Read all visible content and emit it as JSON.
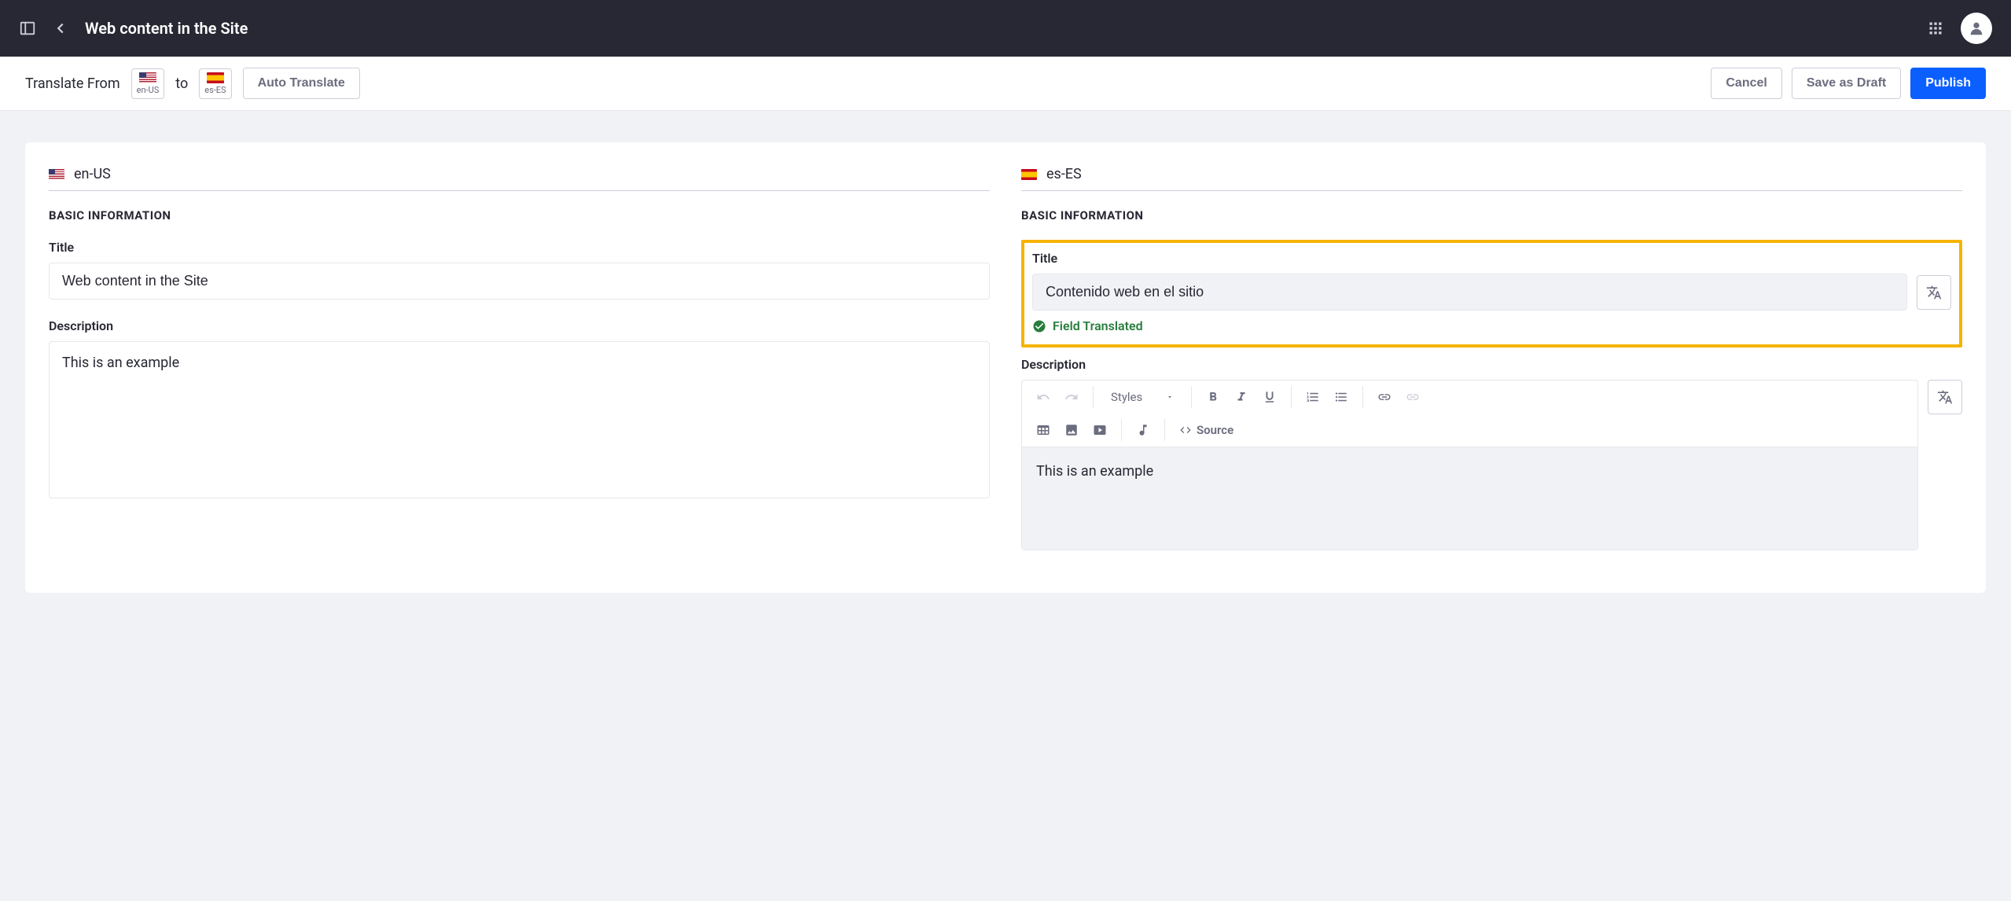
{
  "topbar": {
    "title": "Web content in the Site"
  },
  "toolbar": {
    "translate_from_label": "Translate From",
    "to_label": "to",
    "from_lang": "en-US",
    "to_lang": "es-ES",
    "auto_translate_label": "Auto Translate",
    "cancel_label": "Cancel",
    "save_draft_label": "Save as Draft",
    "publish_label": "Publish"
  },
  "source": {
    "lang": "en-US",
    "section_title": "Basic Information",
    "title_label": "Title",
    "title_value": "Web content in the Site",
    "description_label": "Description",
    "description_value": "This is an example"
  },
  "target": {
    "lang": "es-ES",
    "section_title": "Basic Information",
    "title_label": "Title",
    "title_value": "Contenido web en el sitio",
    "status_text": "Field Translated",
    "description_label": "Description",
    "description_value": "This is an example",
    "editor": {
      "styles_label": "Styles",
      "source_label": "Source"
    }
  }
}
